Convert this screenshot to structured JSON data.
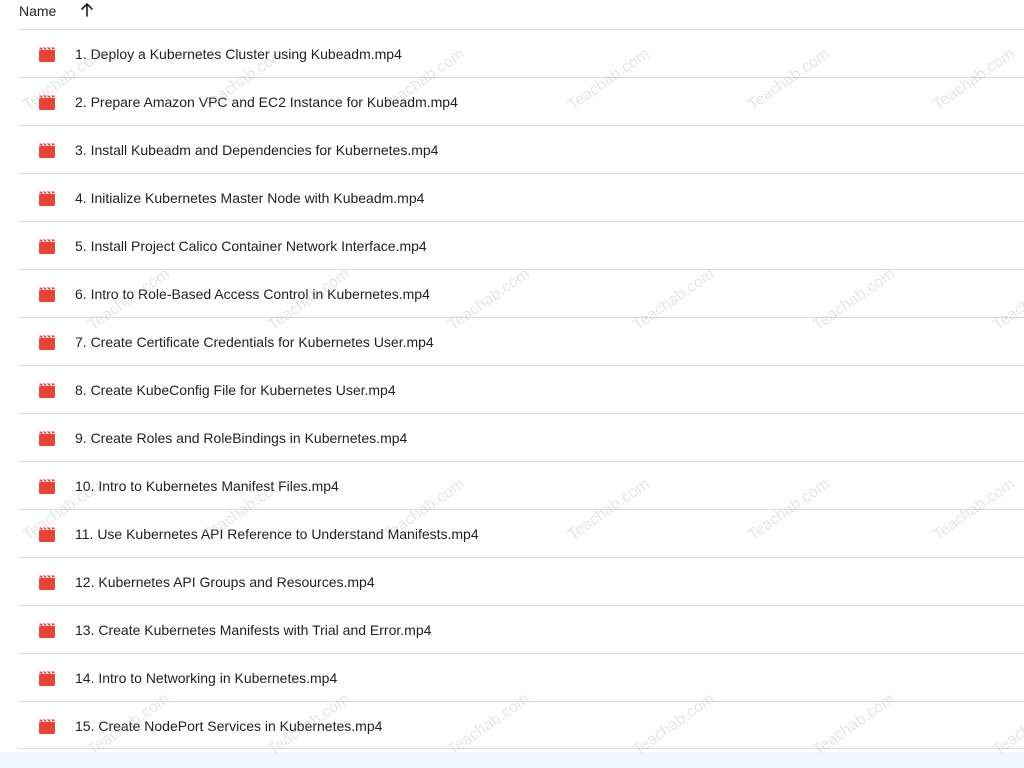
{
  "header": {
    "name_label": "Name",
    "sort_icon": "arrow-up-icon"
  },
  "files": [
    {
      "name": "1. Deploy a Kubernetes Cluster using Kubeadm.mp4",
      "icon": "video-file-icon"
    },
    {
      "name": "2. Prepare Amazon VPC and EC2 Instance for Kubeadm.mp4",
      "icon": "video-file-icon"
    },
    {
      "name": "3. Install Kubeadm and Dependencies for Kubernetes.mp4",
      "icon": "video-file-icon"
    },
    {
      "name": "4. Initialize Kubernetes Master Node with Kubeadm.mp4",
      "icon": "video-file-icon"
    },
    {
      "name": "5. Install Project Calico Container Network Interface.mp4",
      "icon": "video-file-icon"
    },
    {
      "name": "6. Intro to Role-Based Access Control in Kubernetes.mp4",
      "icon": "video-file-icon"
    },
    {
      "name": "7. Create Certificate Credentials for Kubernetes User.mp4",
      "icon": "video-file-icon"
    },
    {
      "name": "8. Create KubeConfig File for Kubernetes User.mp4",
      "icon": "video-file-icon"
    },
    {
      "name": "9. Create Roles and RoleBindings in Kubernetes.mp4",
      "icon": "video-file-icon"
    },
    {
      "name": "10. Intro to Kubernetes Manifest Files.mp4",
      "icon": "video-file-icon"
    },
    {
      "name": "11. Use Kubernetes API Reference to Understand Manifests.mp4",
      "icon": "video-file-icon"
    },
    {
      "name": "12. Kubernetes API Groups and Resources.mp4",
      "icon": "video-file-icon"
    },
    {
      "name": "13. Create Kubernetes Manifests with Trial and Error.mp4",
      "icon": "video-file-icon"
    },
    {
      "name": "14. Intro to Networking in Kubernetes.mp4",
      "icon": "video-file-icon"
    },
    {
      "name": "15. Create NodePort Services in Kubernetes.mp4",
      "icon": "video-file-icon"
    }
  ],
  "watermark_text": "Teachab.com",
  "colors": {
    "icon_red": "#ea4335",
    "divider": "#dadce0",
    "text": "#1f1f1f"
  }
}
